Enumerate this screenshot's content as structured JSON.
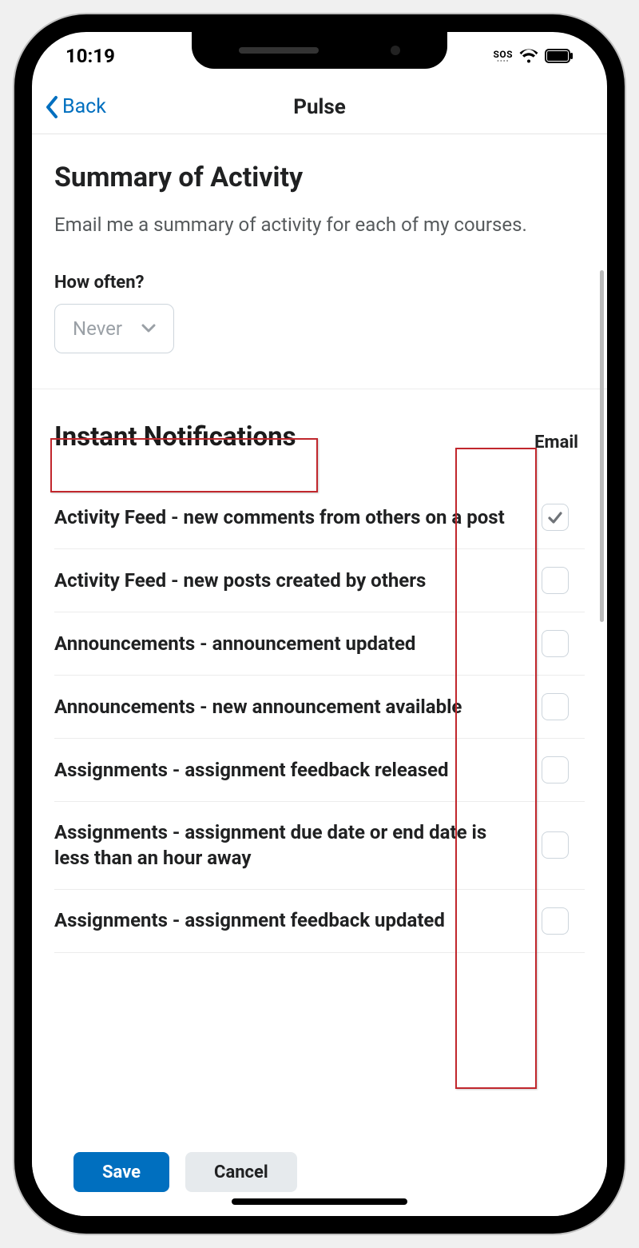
{
  "statusbar": {
    "time": "10:19",
    "sos": "SOS"
  },
  "navbar": {
    "back_label": "Back",
    "title": "Pulse"
  },
  "summary": {
    "heading": "Summary of Activity",
    "description": "Email me a summary of activity for each of my courses.",
    "how_often_label": "How often?",
    "frequency_value": "Never"
  },
  "instant_notifications": {
    "heading": "Instant Notifications",
    "column_label": "Email",
    "rows": [
      {
        "label": "Activity Feed - new comments from others on a post",
        "checked": true
      },
      {
        "label": "Activity Feed - new posts created by others",
        "checked": false
      },
      {
        "label": "Announcements - announcement updated",
        "checked": false
      },
      {
        "label": "Announcements - new announcement available",
        "checked": false
      },
      {
        "label": "Assignments - assignment feedback released",
        "checked": false
      },
      {
        "label": "Assignments - assignment due date or end date is less than an hour away",
        "checked": false
      },
      {
        "label": "Assignments - assignment feedback updated",
        "checked": false
      }
    ]
  },
  "footer": {
    "save_label": "Save",
    "cancel_label": "Cancel"
  },
  "colors": {
    "link": "#006fbf",
    "highlight": "#c1272d"
  }
}
